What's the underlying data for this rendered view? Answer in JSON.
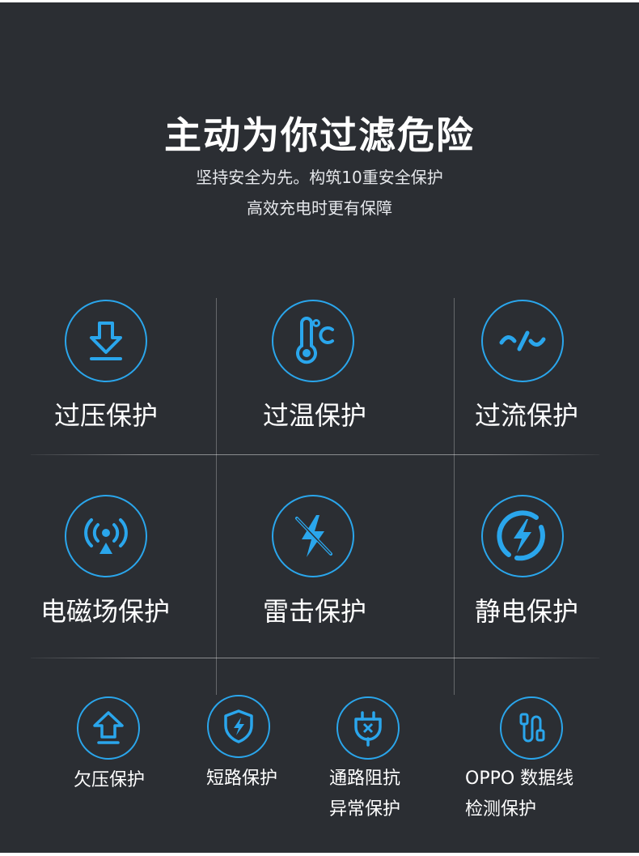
{
  "header": {
    "title": "主动为你过滤危险",
    "subtitle_line1": "坚持安全为先。构筑10重安全保护",
    "subtitle_line2": "高效充电时更有保障"
  },
  "accent_color": "#2aa6ec",
  "background_color": "#2b2e33",
  "protections": {
    "overvoltage": {
      "label": "过压保护",
      "icon": "download-arrow-icon"
    },
    "overtemp": {
      "label": "过温保护",
      "icon": "thermometer-celsius-icon"
    },
    "overcurrent": {
      "label": "过流保护",
      "icon": "current-wave-icon"
    },
    "emf": {
      "label": "电磁场保护",
      "icon": "signal-tower-icon"
    },
    "lightning": {
      "label": "雷击保护",
      "icon": "lightning-crossed-icon"
    },
    "static": {
      "label": "静电保护",
      "icon": "lightning-circle-icon"
    },
    "undervoltage": {
      "label": "欠压保护",
      "icon": "up-arrow-icon"
    },
    "shortcircuit": {
      "label": "短路保护",
      "icon": "shield-lightning-icon"
    },
    "impedance": {
      "label_line1": "通路阻抗",
      "label_line2": "异常保护",
      "icon": "plug-x-icon"
    },
    "cable": {
      "label_line1": "OPPO 数据线",
      "label_line2": "检测保护",
      "icon": "cable-icon"
    }
  }
}
